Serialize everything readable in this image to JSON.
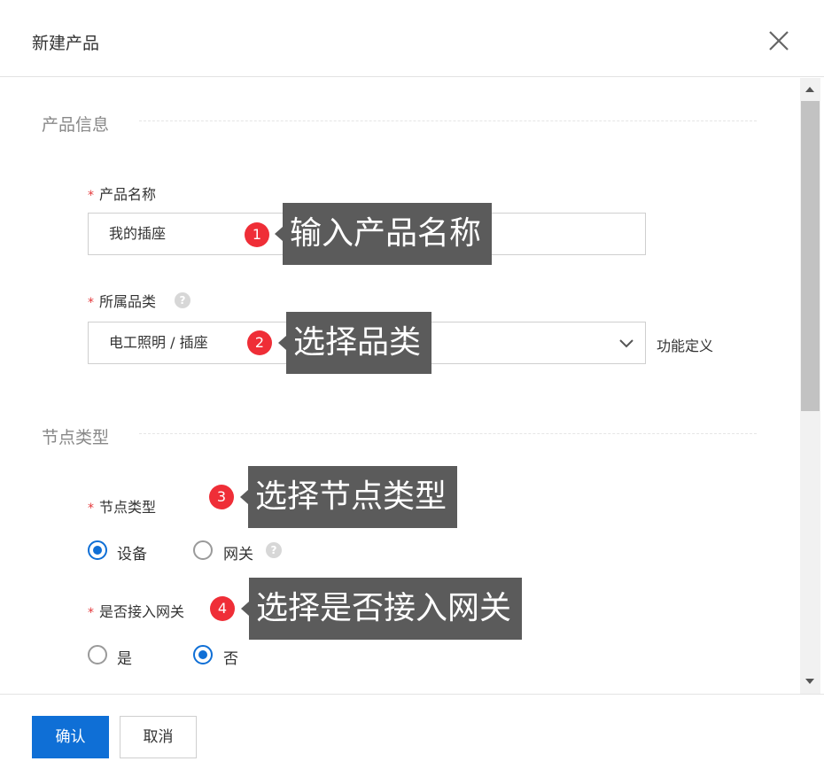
{
  "dialog": {
    "title": "新建产品",
    "confirm_label": "确认",
    "cancel_label": "取消"
  },
  "product_info": {
    "section_title": "产品信息",
    "name": {
      "required_mark": "*",
      "label": "产品名称",
      "value": "我的插座"
    },
    "category": {
      "required_mark": "*",
      "label": "所属品类",
      "help": "?",
      "value": "电工照明 / 插座",
      "side_link": "功能定义"
    }
  },
  "node_type": {
    "section_title": "节点类型",
    "type": {
      "required_mark": "*",
      "label": "节点类型",
      "options": [
        {
          "label": "设备",
          "checked": true
        },
        {
          "label": "网关",
          "checked": false
        }
      ],
      "help": "?"
    },
    "gateway": {
      "required_mark": "*",
      "label": "是否接入网关",
      "options": [
        {
          "label": "是",
          "checked": false
        },
        {
          "label": "否",
          "checked": true
        }
      ]
    }
  },
  "annotations": [
    {
      "number": "1",
      "text": "输入产品名称"
    },
    {
      "number": "2",
      "text": "选择品类"
    },
    {
      "number": "3",
      "text": "选择节点类型"
    },
    {
      "number": "4",
      "text": "选择是否接入网关"
    }
  ],
  "icons": {
    "close": "close-icon",
    "chevron": "chevron-down-icon",
    "help": "help-icon"
  },
  "colors": {
    "primary": "#0f6fd6",
    "required": "#e4393c",
    "badge": "#ef2e37",
    "callout": "#5b5b5b"
  }
}
